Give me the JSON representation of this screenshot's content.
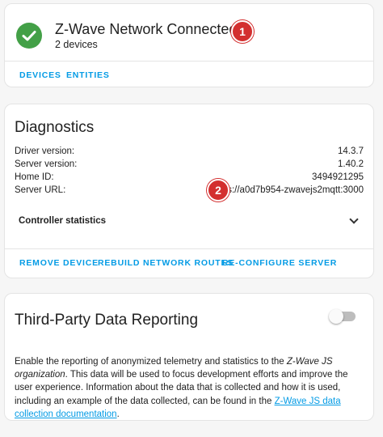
{
  "status_card": {
    "title": "Z-Wave Network Connected",
    "subtitle": "2 devices",
    "marker": "1",
    "actions": [
      "DEVICES",
      "ENTITIES"
    ],
    "icon": "check-circle-icon",
    "status_color": "#43a047"
  },
  "diagnostics_card": {
    "title": "Diagnostics",
    "rows": [
      {
        "label": "Driver version:",
        "value": "14.3.7"
      },
      {
        "label": "Server version:",
        "value": "1.40.2"
      },
      {
        "label": "Home ID:",
        "value": "3494921295"
      },
      {
        "label": "Server URL:",
        "value": "ws://a0d7b954-zwavejs2mqtt:3000"
      }
    ],
    "marker": "2",
    "expander_label": "Controller statistics",
    "actions": [
      "REMOVE DEVICE",
      "REBUILD NETWORK ROUTES",
      "RE-CONFIGURE SERVER"
    ]
  },
  "privacy_card": {
    "title": "Third-Party Data Reporting",
    "toggle_on": false,
    "text_before_em": "Enable the reporting of anonymized telemetry and statistics to the ",
    "text_em": "Z-Wave JS organization",
    "text_after_em": ". This data will be used to focus development efforts and improve the user experience. Information about the data that is collected and how it is used, including an example of the data collected, can be found in the ",
    "link_text": "Z-Wave JS data collection documentation",
    "text_end": "."
  },
  "colors": {
    "accent": "#039be5",
    "marker": "#d32f2f",
    "background": "#f6f6f6"
  }
}
